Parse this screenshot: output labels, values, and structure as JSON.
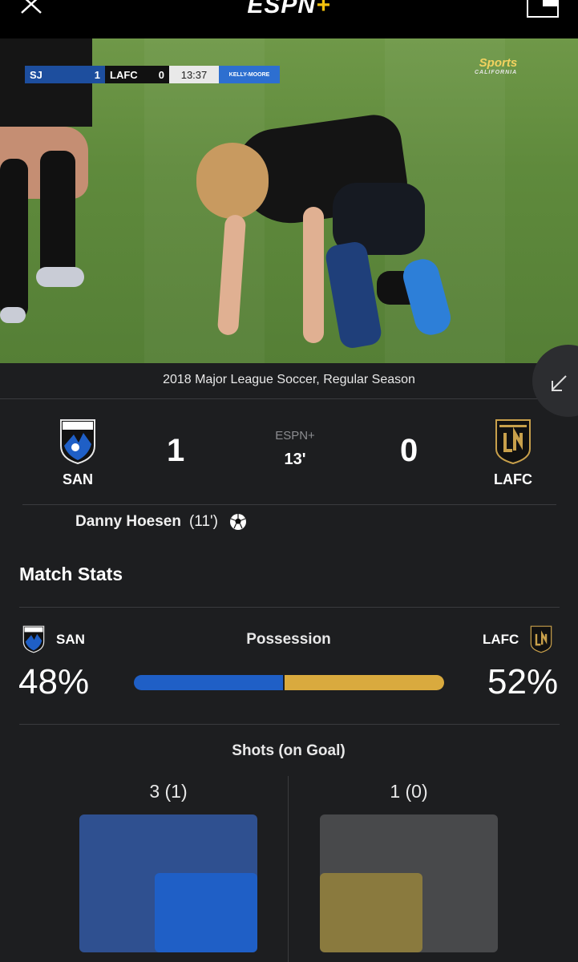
{
  "header": {
    "brand": "ESPN",
    "brand_plus": "+"
  },
  "video": {
    "scorebug": {
      "home": "SJ",
      "home_score": "1",
      "away": "LAFC",
      "away_score": "0",
      "time": "13:37",
      "sponsor": "KELLY-MOORE"
    },
    "network": {
      "name": "Sports",
      "region": "CALIFORNIA"
    }
  },
  "match": {
    "league": "2018 Major League Soccer, Regular Season",
    "network": "ESPN+",
    "clock": "13'",
    "home": {
      "abbr": "SAN",
      "score": "1",
      "crest_text": "QUAKES",
      "color": "#1f5fc6"
    },
    "away": {
      "abbr": "LAFC",
      "score": "0",
      "crest_text": "LA",
      "color": "#c8a04b"
    },
    "scorers": [
      {
        "name": "Danny Hoesen",
        "minute": "(11')"
      }
    ]
  },
  "stats": {
    "title": "Match Stats",
    "possession": {
      "label": "Possession",
      "home_pct": "48%",
      "away_pct": "52%",
      "home_value": 48,
      "away_value": 52
    },
    "shots": {
      "label": "Shots (on Goal)",
      "home_text": "3 (1)",
      "away_text": "1 (0)",
      "home_total": 3,
      "home_on_goal": 1,
      "away_total": 1,
      "away_on_goal": 0
    }
  },
  "colors": {
    "home": "#1f5fc6",
    "home_shots_bg": "#2f5090",
    "away": "#d9aa3e",
    "away_shots_fill": "#8a7a3e",
    "away_shots_bg": "#48494b"
  }
}
